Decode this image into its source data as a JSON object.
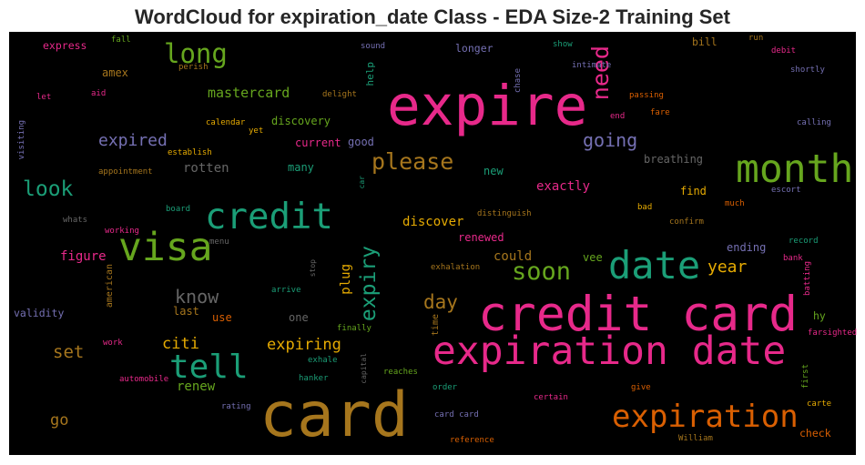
{
  "chart_data": {
    "type": "wordcloud",
    "title": "WordCloud for expiration_date Class - EDA Size-2 Training Set",
    "background": "#000000",
    "words": [
      {
        "text": "expire",
        "color": "#e7298a"
      },
      {
        "text": "card",
        "color": "#a6761d"
      },
      {
        "text": "credit card",
        "color": "#e7298a"
      },
      {
        "text": "expiration date",
        "color": "#e7298a"
      },
      {
        "text": "month",
        "color": "#66a61e"
      },
      {
        "text": "date",
        "color": "#1b9e77"
      },
      {
        "text": "visa",
        "color": "#66a61e"
      },
      {
        "text": "credit",
        "color": "#1b9e77"
      },
      {
        "text": "tell",
        "color": "#1b9e77"
      },
      {
        "text": "expiration",
        "color": "#d95f02"
      },
      {
        "text": "long",
        "color": "#66a61e"
      },
      {
        "text": "soon",
        "color": "#66a61e"
      },
      {
        "text": "please",
        "color": "#a6761d"
      },
      {
        "text": "need",
        "color": "#e7298a"
      },
      {
        "text": "expiry",
        "color": "#1b9e77"
      },
      {
        "text": "look",
        "color": "#1b9e77"
      },
      {
        "text": "mastercard",
        "color": "#66a61e"
      },
      {
        "text": "expired",
        "color": "#7570b3"
      },
      {
        "text": "going",
        "color": "#7570b3"
      },
      {
        "text": "know",
        "color": "#666666"
      },
      {
        "text": "day",
        "color": "#a6761d"
      },
      {
        "text": "year",
        "color": "#e6ab02"
      },
      {
        "text": "set",
        "color": "#a6761d"
      },
      {
        "text": "citi",
        "color": "#e6ab02"
      },
      {
        "text": "go",
        "color": "#a6761d"
      },
      {
        "text": "expiring",
        "color": "#e6ab02"
      },
      {
        "text": "could",
        "color": "#a6761d"
      },
      {
        "text": "discover",
        "color": "#e6ab02"
      },
      {
        "text": "exactly",
        "color": "#e7298a"
      },
      {
        "text": "figure",
        "color": "#e7298a"
      },
      {
        "text": "renew",
        "color": "#66a61e"
      },
      {
        "text": "rotten",
        "color": "#666666"
      },
      {
        "text": "current",
        "color": "#e7298a"
      },
      {
        "text": "good",
        "color": "#7570b3"
      },
      {
        "text": "many",
        "color": "#1b9e77"
      },
      {
        "text": "discovery",
        "color": "#66a61e"
      },
      {
        "text": "breathing",
        "color": "#666666"
      },
      {
        "text": "find",
        "color": "#e6ab02"
      },
      {
        "text": "ending",
        "color": "#7570b3"
      },
      {
        "text": "renewed",
        "color": "#e7298a"
      },
      {
        "text": "new",
        "color": "#1b9e77"
      },
      {
        "text": "vee",
        "color": "#66a61e"
      },
      {
        "text": "longer",
        "color": "#7570b3"
      },
      {
        "text": "validity",
        "color": "#7570b3"
      },
      {
        "text": "express",
        "color": "#e7298a"
      },
      {
        "text": "amex",
        "color": "#a6761d"
      },
      {
        "text": "last",
        "color": "#a6761d"
      },
      {
        "text": "use",
        "color": "#d95f02"
      },
      {
        "text": "one",
        "color": "#666666"
      },
      {
        "text": "plug",
        "color": "#e6ab02"
      },
      {
        "text": "hy",
        "color": "#66a61e"
      },
      {
        "text": "check",
        "color": "#d95f02"
      },
      {
        "text": "bill",
        "color": "#a6761d"
      },
      {
        "text": "fall",
        "color": "#66a61e"
      },
      {
        "text": "perish",
        "color": "#a6761d"
      },
      {
        "text": "let",
        "color": "#e7298a"
      },
      {
        "text": "aid",
        "color": "#e7298a"
      },
      {
        "text": "calendar",
        "color": "#e6ab02"
      },
      {
        "text": "yet",
        "color": "#e6ab02"
      },
      {
        "text": "establish",
        "color": "#e6ab02"
      },
      {
        "text": "appointment",
        "color": "#a6761d"
      },
      {
        "text": "board",
        "color": "#1b9e77"
      },
      {
        "text": "whats",
        "color": "#666666"
      },
      {
        "text": "working",
        "color": "#e7298a"
      },
      {
        "text": "menu",
        "color": "#666666"
      },
      {
        "text": "arrive",
        "color": "#1b9e77"
      },
      {
        "text": "work",
        "color": "#e7298a"
      },
      {
        "text": "automobile",
        "color": "#e7298a"
      },
      {
        "text": "rating",
        "color": "#7570b3"
      },
      {
        "text": "finally",
        "color": "#66a61e"
      },
      {
        "text": "exhale",
        "color": "#1b9e77"
      },
      {
        "text": "hanker",
        "color": "#1b9e77"
      },
      {
        "text": "reaches",
        "color": "#66a61e"
      },
      {
        "text": "order",
        "color": "#1b9e77"
      },
      {
        "text": "card card",
        "color": "#7570b3"
      },
      {
        "text": "reference",
        "color": "#d95f02"
      },
      {
        "text": "certain",
        "color": "#e7298a"
      },
      {
        "text": "give",
        "color": "#d95f02"
      },
      {
        "text": "William",
        "color": "#a6761d"
      },
      {
        "text": "exhalation",
        "color": "#a6761d"
      },
      {
        "text": "distinguish",
        "color": "#a6761d"
      },
      {
        "text": "sound",
        "color": "#7570b3"
      },
      {
        "text": "delight",
        "color": "#a6761d"
      },
      {
        "text": "show",
        "color": "#1b9e77"
      },
      {
        "text": "intimate",
        "color": "#7570b3"
      },
      {
        "text": "passing",
        "color": "#d95f02"
      },
      {
        "text": "end",
        "color": "#e7298a"
      },
      {
        "text": "fare",
        "color": "#d95f02"
      },
      {
        "text": "run",
        "color": "#a6761d"
      },
      {
        "text": "debit",
        "color": "#e7298a"
      },
      {
        "text": "shortly",
        "color": "#7570b3"
      },
      {
        "text": "calling",
        "color": "#7570b3"
      },
      {
        "text": "escort",
        "color": "#7570b3"
      },
      {
        "text": "much",
        "color": "#d95f02"
      },
      {
        "text": "bad",
        "color": "#e6ab02"
      },
      {
        "text": "confirm",
        "color": "#a6761d"
      },
      {
        "text": "record",
        "color": "#1b9e77"
      },
      {
        "text": "bank",
        "color": "#e7298a"
      },
      {
        "text": "farsighted",
        "color": "#e7298a"
      },
      {
        "text": "carte",
        "color": "#e6ab02"
      },
      {
        "text": "visiting",
        "color": "#7570b3"
      },
      {
        "text": "american",
        "color": "#a6761d"
      },
      {
        "text": "stop",
        "color": "#666666"
      },
      {
        "text": "capital",
        "color": "#666666"
      },
      {
        "text": "time",
        "color": "#a6761d"
      },
      {
        "text": "car",
        "color": "#1b9e77"
      },
      {
        "text": "help",
        "color": "#1b9e77"
      },
      {
        "text": "chase",
        "color": "#7570b3"
      },
      {
        "text": "batting",
        "color": "#e7298a"
      },
      {
        "text": "first",
        "color": "#66a61e"
      }
    ]
  }
}
